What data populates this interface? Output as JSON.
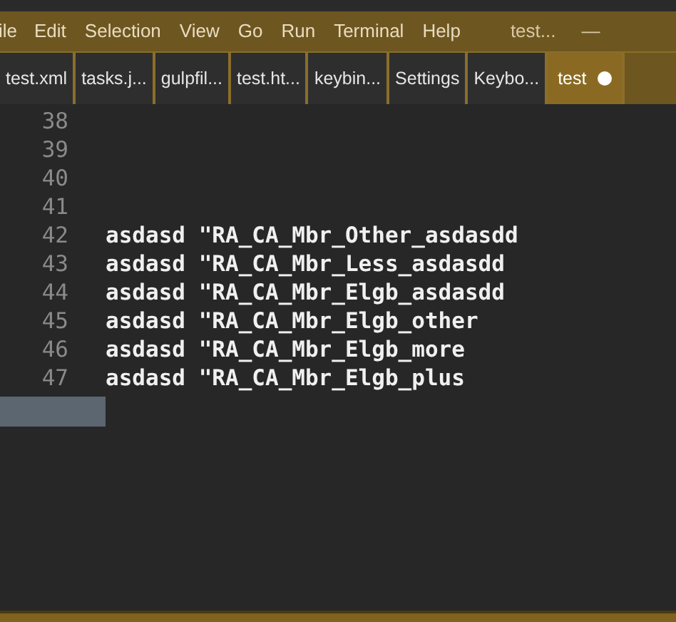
{
  "menu_bar": {
    "items": [
      "ile",
      "Edit",
      "Selection",
      "View",
      "Go",
      "Run",
      "Terminal",
      "Help"
    ],
    "title": "test...",
    "minimize": "—"
  },
  "tabs": [
    {
      "label": "test.xml",
      "selected": false,
      "modified": false
    },
    {
      "label": "tasks.j...",
      "selected": false,
      "modified": false
    },
    {
      "label": "gulpfil...",
      "selected": false,
      "modified": false
    },
    {
      "label": "test.ht...",
      "selected": false,
      "modified": false
    },
    {
      "label": "keybin...",
      "selected": false,
      "modified": false
    },
    {
      "label": "Settings",
      "selected": false,
      "modified": false
    },
    {
      "label": "Keybo...",
      "selected": false,
      "modified": false
    },
    {
      "label": "test",
      "selected": true,
      "modified": true
    }
  ],
  "editor": {
    "lines": [
      {
        "number": "38"
      },
      {
        "number": "39"
      },
      {
        "number": "40"
      },
      {
        "number": "41"
      },
      {
        "number": "42",
        "text": "asdasd \"RA_CA_Mbr_Other_asdasdd"
      },
      {
        "number": "43",
        "text": "asdasd \"RA_CA_Mbr_Less_asdasdd"
      },
      {
        "number": "44",
        "text": "asdasd \"RA_CA_Mbr_Elgb_asdasdd"
      },
      {
        "number": "45",
        "text": "asdasd \"RA_CA_Mbr_Elgb_other"
      },
      {
        "number": "46",
        "text": "asdasd \"RA_CA_Mbr_Elgb_more"
      },
      {
        "number": "47",
        "text": "asdasd \"RA_CA_Mbr_Elgb_plus"
      }
    ]
  }
}
